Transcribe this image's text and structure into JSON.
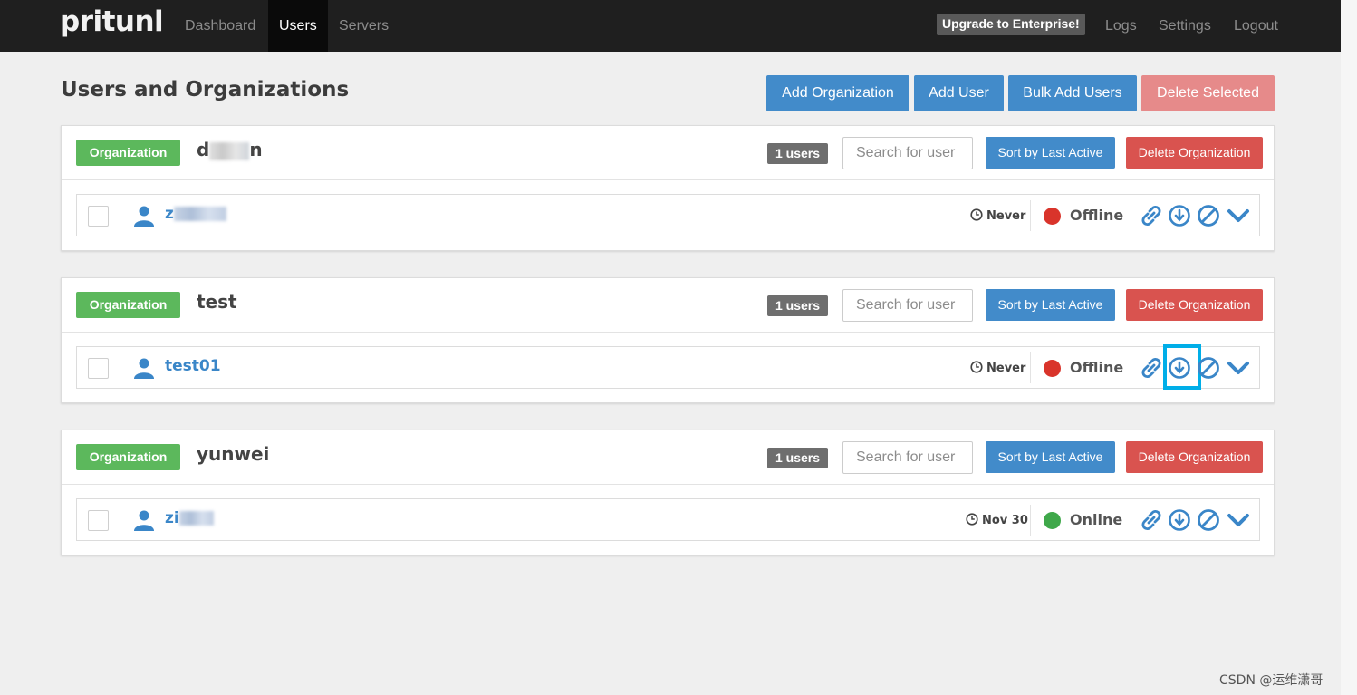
{
  "nav": {
    "brand": "pritunl",
    "links": [
      "Dashboard",
      "Users",
      "Servers"
    ],
    "upgrade_label": "Upgrade to Enterprise!",
    "right_links": [
      "Logs",
      "Settings",
      "Logout"
    ]
  },
  "page": {
    "title": "Users and Organizations",
    "buttons": {
      "add_org": "Add Organization",
      "add_user": "Add User",
      "bulk_add": "Bulk Add Users",
      "delete_selected": "Delete Selected"
    }
  },
  "org_common": {
    "label": "Organization",
    "search_placeholder": "Search for user",
    "sort_label": "Sort by Last Active",
    "delete_label": "Delete Organization"
  },
  "orgs": [
    {
      "name_start": "d",
      "name_end": "n",
      "count": "1 users",
      "user": {
        "name": "z",
        "last_active": "Never",
        "status": "Offline"
      }
    },
    {
      "name": "test",
      "count": "1 users",
      "user": {
        "name": "test01",
        "last_active": "Never",
        "status": "Offline"
      }
    },
    {
      "name": "yunwei",
      "count": "1 users",
      "user": {
        "name": "zi",
        "last_active": "Nov 30",
        "status": "Online"
      }
    }
  ],
  "icons": [
    "user-icon",
    "clock-icon",
    "link-icon",
    "download-icon",
    "disable-icon",
    "chevron-down-icon"
  ],
  "colors": {
    "offline": "#d9342b",
    "online": "#3fa84a",
    "accent": "#428bca",
    "highlight": "#00aee8"
  },
  "watermark": "CSDN @运维潇哥"
}
